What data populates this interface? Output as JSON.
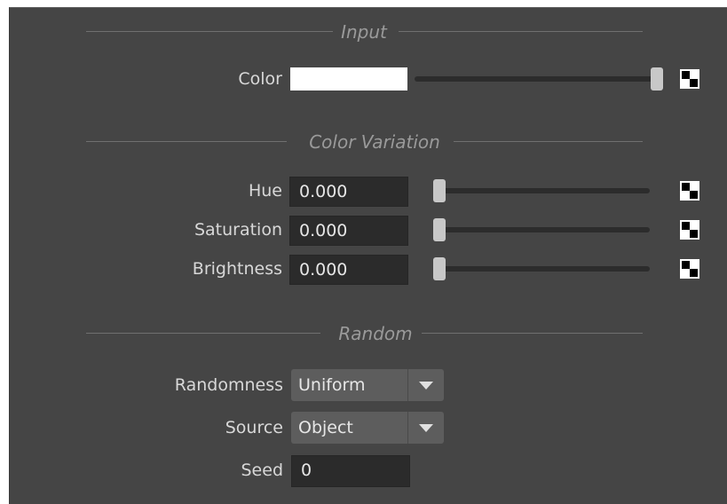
{
  "sections": {
    "input": {
      "title": "Input"
    },
    "color_variation": {
      "title": "Color Variation"
    },
    "random": {
      "title": "Random"
    }
  },
  "input": {
    "color_label": "Color",
    "color_value": "#ffffff",
    "color_slider_fraction": 1.0
  },
  "variation": {
    "hue": {
      "label": "Hue",
      "value": "0.000",
      "slider_fraction": 0.0
    },
    "saturation": {
      "label": "Saturation",
      "value": "0.000",
      "slider_fraction": 0.0
    },
    "brightness": {
      "label": "Brightness",
      "value": "0.000",
      "slider_fraction": 0.0
    }
  },
  "random": {
    "randomness": {
      "label": "Randomness",
      "value": "Uniform"
    },
    "source": {
      "label": "Source",
      "value": "Object"
    },
    "seed": {
      "label": "Seed",
      "value": "0"
    }
  }
}
